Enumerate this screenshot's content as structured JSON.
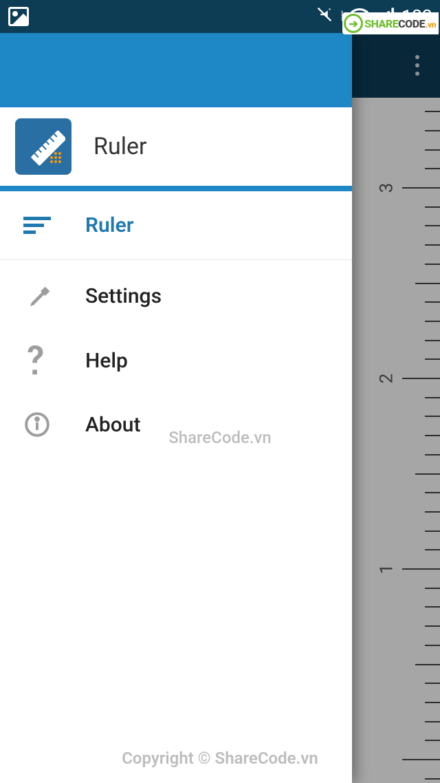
{
  "status": {
    "battery": "100"
  },
  "badge": {
    "share": "SHARE",
    "code": "CODE",
    "vn": ".vn"
  },
  "drawer": {
    "app_title": "Ruler",
    "items": [
      {
        "label": "Ruler",
        "icon": "list-icon",
        "active": true
      },
      {
        "label": "Settings",
        "icon": "wrench-icon",
        "active": false
      },
      {
        "label": "Help",
        "icon": "help-icon",
        "active": false
      },
      {
        "label": "About",
        "icon": "info-icon",
        "active": false
      }
    ]
  },
  "ruler_numbers": [
    "3",
    "2",
    "1"
  ],
  "watermark_center": "ShareCode.vn",
  "watermark_bottom": "Copyright © ShareCode.vn"
}
